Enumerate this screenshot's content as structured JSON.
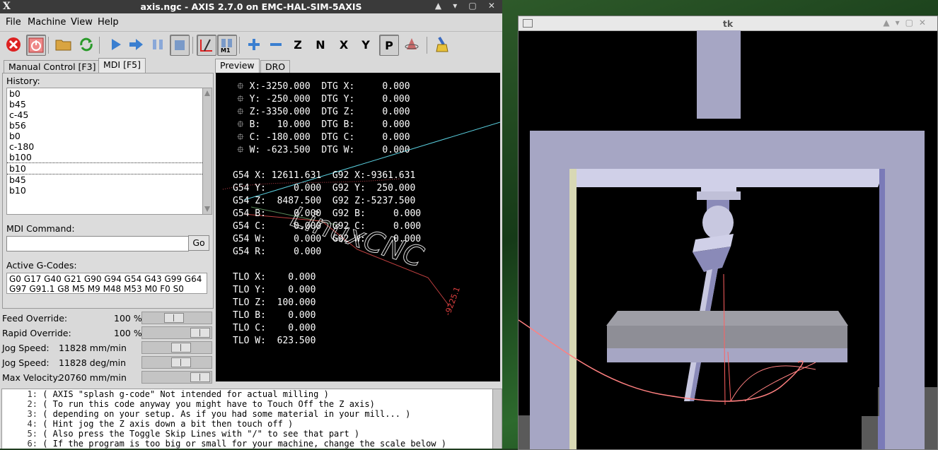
{
  "axis_window": {
    "title": "axis.ngc - AXIS 2.7.0 on EMC-HAL-SIM-5AXIS",
    "x_logo": "X",
    "controls": "▲ ▾ ▢ ✕"
  },
  "menu": [
    "File",
    "Machine",
    "View",
    "Help"
  ],
  "tabs_left": [
    "Manual Control [F3]",
    "MDI [F5]"
  ],
  "tabs_right": [
    "Preview",
    "DRO"
  ],
  "mdi": {
    "history_label": "History:",
    "history": [
      "b0",
      "b45",
      "c-45",
      "b56",
      "b0",
      "c-180",
      "b100",
      "b10",
      "b45",
      "b10"
    ],
    "command_label": "MDI Command:",
    "command_value": "",
    "go_label": "Go",
    "active_gcodes_label": "Active G-Codes:",
    "active_gcodes": "G0 G17 G40 G21 G90 G94 G54 G43 G99 G64 G97 G91.1 G8 M5 M9 M48 M53 M0 F0 S0"
  },
  "overrides": [
    {
      "name": "Feed Override:",
      "value": "100 %",
      "level": 0.45
    },
    {
      "name": "Rapid Override:",
      "value": "100 %",
      "level": 1.0
    },
    {
      "name": "Jog Speed:",
      "value": "11828 mm/min",
      "level": 0.6
    },
    {
      "name": "Jog Speed:",
      "value": "11828 deg/min",
      "level": 0.6
    },
    {
      "name": "Max Velocity:",
      "value": "20760 mm/min",
      "level": 1.0
    }
  ],
  "dro": [
    "X:-3250.000  DTG X:     0.000",
    "Y: -250.000  DTG Y:     0.000",
    "Z:-3350.000  DTG Z:     0.000",
    "B:   10.000  DTG B:     0.000",
    "C: -180.000  DTG C:     0.000",
    "W: -623.500  DTG W:     0.000"
  ],
  "offsets": [
    "G54 X: 12611.631  G92 X:-9361.631",
    "G54 Y:     0.000  G92 Y:  250.000",
    "G54 Z:  8487.500  G92 Z:-5237.500",
    "G54 B:     0.000  G92 B:     0.000",
    "G54 C:     0.000  G92 C:     0.000",
    "G54 W:     0.000  G92 W:     0.000",
    "G54 R:     0.000"
  ],
  "tlo": [
    "TLO X:    0.000",
    "TLO Y:    0.000",
    "TLO Z:  100.000",
    "TLO B:    0.000",
    "TLO C:    0.000",
    "TLO W:  623.500"
  ],
  "preview_text": {
    "logo": "LinuxCNC",
    "dim1": "-9225.1"
  },
  "gcode": [
    {
      "n": "1:",
      "t": "( AXIS \"splash g-code\" Not intended for actual milling )"
    },
    {
      "n": "2:",
      "t": "( To run this code anyway you might have to Touch Off the Z axis)"
    },
    {
      "n": "3:",
      "t": "( depending on your setup. As if you had some material in your mill... )"
    },
    {
      "n": "4:",
      "t": "( Hint jog the Z axis down a bit then touch off )"
    },
    {
      "n": "5:",
      "t": "( Also press the Toggle Skip Lines with \"/\" to see that part )"
    },
    {
      "n": "6:",
      "t": "( If the program is too big or small for your machine, change the scale below )"
    }
  ],
  "tk_window": {
    "title": "tk"
  },
  "colors": {
    "frame": "#a6a6c4",
    "frame_side": "#8a8ab8",
    "spindle": "#d0d0e8",
    "path": "#ff8080"
  }
}
